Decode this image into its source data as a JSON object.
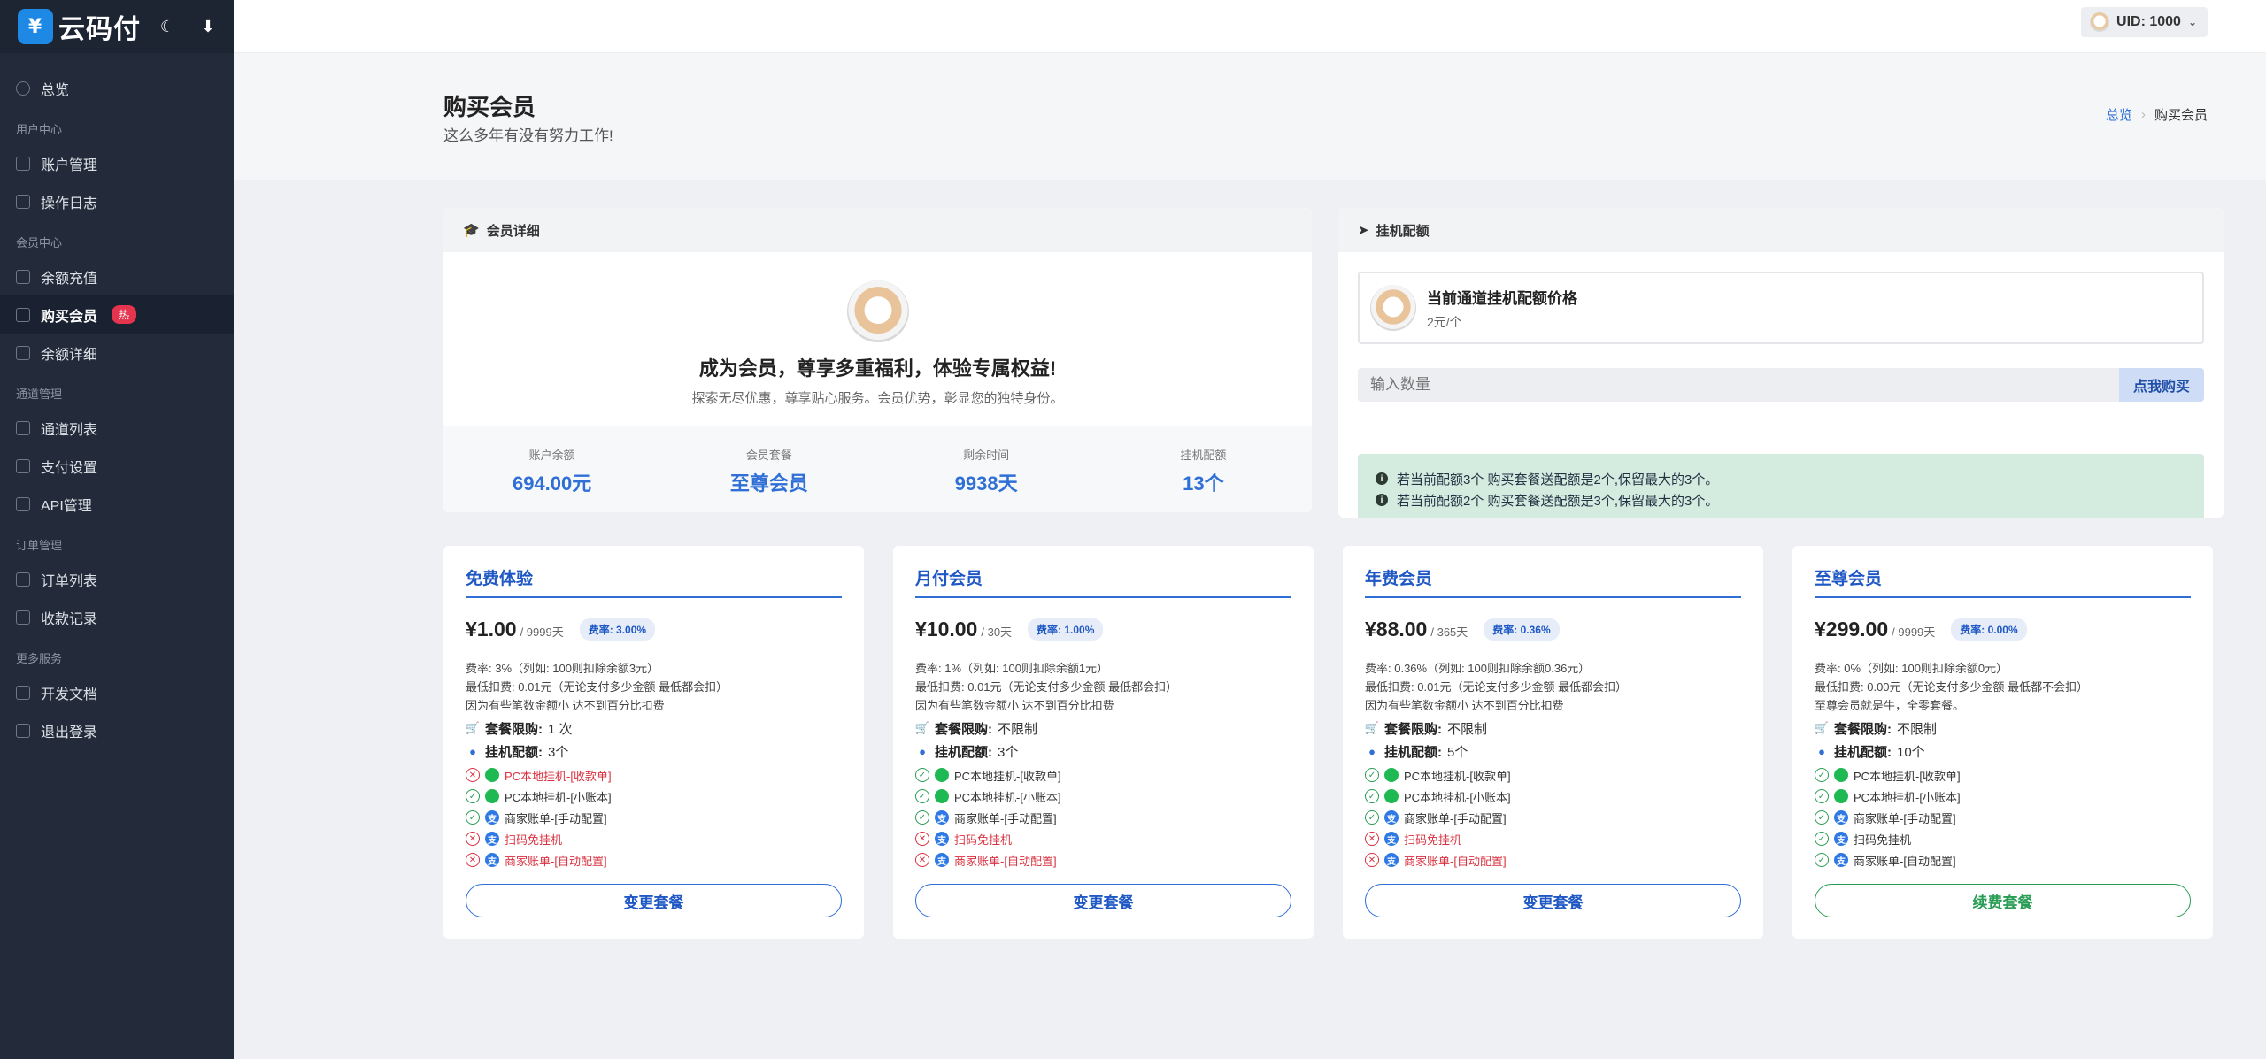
{
  "app": {
    "logo_text": "云码付",
    "logo_glyph": "¥"
  },
  "sidebar": {
    "items": [
      {
        "type": "item",
        "label": "总览",
        "icon": "dashboard-icon"
      },
      {
        "type": "section",
        "label": "用户中心"
      },
      {
        "type": "item",
        "label": "账户管理",
        "icon": "user-icon"
      },
      {
        "type": "item",
        "label": "操作日志",
        "icon": "log-icon"
      },
      {
        "type": "section",
        "label": "会员中心"
      },
      {
        "type": "item",
        "label": "余额充值",
        "icon": "wallet-icon"
      },
      {
        "type": "item",
        "label": "购买会员",
        "icon": "gift-icon",
        "active": true,
        "badge": "热"
      },
      {
        "type": "item",
        "label": "余额详细",
        "icon": "sliders-icon"
      },
      {
        "type": "section",
        "label": "通道管理"
      },
      {
        "type": "item",
        "label": "通道列表",
        "icon": "send-icon"
      },
      {
        "type": "item",
        "label": "支付设置",
        "icon": "grid-icon"
      },
      {
        "type": "item",
        "label": "API管理",
        "icon": "key-icon"
      },
      {
        "type": "section",
        "label": "订单管理"
      },
      {
        "type": "item",
        "label": "订单列表",
        "icon": "layers-icon"
      },
      {
        "type": "item",
        "label": "收款记录",
        "icon": "receipt-icon"
      },
      {
        "type": "section",
        "label": "更多服务"
      },
      {
        "type": "item",
        "label": "开发文档",
        "icon": "doc-icon"
      },
      {
        "type": "item",
        "label": "退出登录",
        "icon": "logout-icon"
      }
    ]
  },
  "topbar": {
    "user_label": "UID:  1000"
  },
  "hero": {
    "title": "购买会员",
    "subtitle": "这么多年有没有努力工作!",
    "breadcrumb": [
      "总览",
      "购买会员"
    ]
  },
  "member": {
    "header": "会员详细",
    "headline": "成为会员，尊享多重福利，体验专属权益!",
    "tagline": "探索无尽优惠，尊享贴心服务。会员优势，彰显您的独特身份。",
    "stats": [
      {
        "label": "账户余额",
        "value": "694.00元"
      },
      {
        "label": "会员套餐",
        "value": "至尊会员"
      },
      {
        "label": "剩余时间",
        "value": "9938天"
      },
      {
        "label": "挂机配额",
        "value": "13个"
      }
    ]
  },
  "quota": {
    "header": "挂机配额",
    "price_title": "当前通道挂机配额价格",
    "price_value": "2元/个",
    "input_placeholder": "输入数量",
    "buy_label": "点我购买",
    "notices": [
      "若当前配额3个 购买套餐送配额是2个,保留最大的3个。",
      "若当前配额2个 购买套餐送配额是3个,保留最大的3个。"
    ]
  },
  "plans": [
    {
      "name": "免费体验",
      "price": "¥1.00",
      "period": "/ 9999天",
      "rate": "费率:  3.00%",
      "desc": [
        "费率:  3%（列如:  100则扣除余额3元）",
        "最低扣费:  0.01元（无论支付多少金额 最低都会扣）",
        "因为有些笔数金额小 达不到百分比扣费"
      ],
      "limit_label": "套餐限购:",
      "limit": "1 次",
      "quota_label": "挂机配额:",
      "quota": "3个",
      "features": [
        {
          "ok": false,
          "icon": "wechat",
          "text": "PC本地挂机-[收款单]"
        },
        {
          "ok": true,
          "icon": "wechat",
          "text": "PC本地挂机-[小账本]"
        },
        {
          "ok": true,
          "icon": "alipay",
          "text": "商家账单-[手动配置]"
        },
        {
          "ok": false,
          "icon": "alipay",
          "text": "扫码免挂机"
        },
        {
          "ok": false,
          "icon": "alipay",
          "text": "商家账单-[自动配置]"
        }
      ],
      "button": "变更套餐",
      "renew": false
    },
    {
      "name": "月付会员",
      "price": "¥10.00",
      "period": "/ 30天",
      "rate": "费率:  1.00%",
      "desc": [
        "费率:  1%（列如:  100则扣除余额1元）",
        "最低扣费:  0.01元（无论支付多少金额 最低都会扣）",
        "因为有些笔数金额小 达不到百分比扣费"
      ],
      "limit_label": "套餐限购:",
      "limit": "不限制",
      "quota_label": "挂机配额:",
      "quota": "3个",
      "features": [
        {
          "ok": true,
          "icon": "wechat",
          "text": "PC本地挂机-[收款单]"
        },
        {
          "ok": true,
          "icon": "wechat",
          "text": "PC本地挂机-[小账本]"
        },
        {
          "ok": true,
          "icon": "alipay",
          "text": "商家账单-[手动配置]"
        },
        {
          "ok": false,
          "icon": "alipay",
          "text": "扫码免挂机"
        },
        {
          "ok": false,
          "icon": "alipay",
          "text": "商家账单-[自动配置]"
        }
      ],
      "button": "变更套餐",
      "renew": false
    },
    {
      "name": "年费会员",
      "price": "¥88.00",
      "period": "/ 365天",
      "rate": "费率:  0.36%",
      "desc": [
        "费率:  0.36%（列如:  100则扣除余额0.36元）",
        "最低扣费:  0.01元（无论支付多少金额 最低都会扣）",
        "因为有些笔数金额小 达不到百分比扣费"
      ],
      "limit_label": "套餐限购:",
      "limit": "不限制",
      "quota_label": "挂机配额:",
      "quota": "5个",
      "features": [
        {
          "ok": true,
          "icon": "wechat",
          "text": "PC本地挂机-[收款单]"
        },
        {
          "ok": true,
          "icon": "wechat",
          "text": "PC本地挂机-[小账本]"
        },
        {
          "ok": true,
          "icon": "alipay",
          "text": "商家账单-[手动配置]"
        },
        {
          "ok": false,
          "icon": "alipay",
          "text": "扫码免挂机"
        },
        {
          "ok": false,
          "icon": "alipay",
          "text": "商家账单-[自动配置]"
        }
      ],
      "button": "变更套餐",
      "renew": false
    },
    {
      "name": "至尊会员",
      "price": "¥299.00",
      "period": "/ 9999天",
      "rate": "费率:  0.00%",
      "desc": [
        "费率:  0%（列如:  100则扣除余额0元）",
        "最低扣费:  0.00元（无论支付多少金额 最低都不会扣）",
        "至尊会员就是牛，全零套餐。"
      ],
      "limit_label": "套餐限购:",
      "limit": "不限制",
      "quota_label": "挂机配额:",
      "quota": "10个",
      "features": [
        {
          "ok": true,
          "icon": "wechat",
          "text": "PC本地挂机-[收款单]"
        },
        {
          "ok": true,
          "icon": "wechat",
          "text": "PC本地挂机-[小账本]"
        },
        {
          "ok": true,
          "icon": "alipay",
          "text": "商家账单-[手动配置]"
        },
        {
          "ok": true,
          "icon": "alipay",
          "text": "扫码免挂机"
        },
        {
          "ok": true,
          "icon": "alipay",
          "text": "商家账单-[自动配置]"
        }
      ],
      "button": "续费套餐",
      "renew": true
    }
  ]
}
